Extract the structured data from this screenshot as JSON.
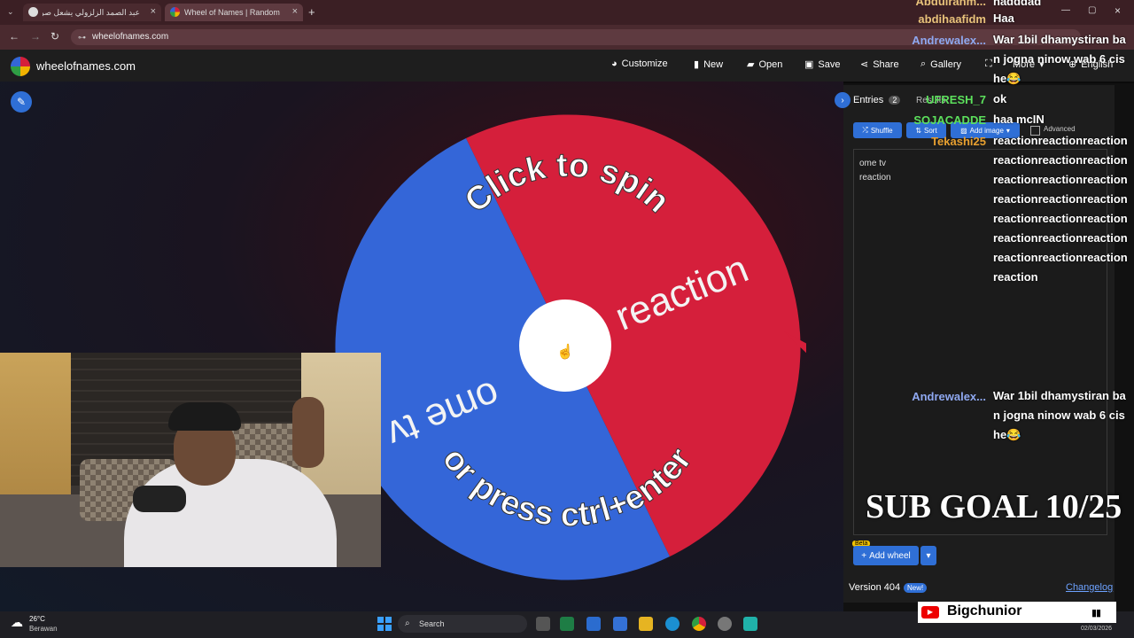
{
  "browser": {
    "tabs": [
      {
        "label": "عبد الصمد الزلزولي يشعل صراعا"
      },
      {
        "label": "Wheel of Names | Random nam"
      }
    ],
    "url": "wheelofnames.com"
  },
  "app": {
    "logo_text": "wheelofnames.com",
    "menu": [
      "Customize",
      "New",
      "Open",
      "Save",
      "Share",
      "Gallery",
      "More",
      "English"
    ]
  },
  "wheel": {
    "top_text": "Click to spin",
    "bottom_text": "or press ctrl+enter",
    "segments": [
      {
        "label": "reaction",
        "color": "#d51f3b"
      },
      {
        "label": "ome tv",
        "color": "#3466d8"
      }
    ]
  },
  "panel": {
    "tab_entries": "Entries",
    "entries_count": "2",
    "tab_results": "Results",
    "shuffle": "Shuffle",
    "sort": "Sort",
    "add_image": "Add image",
    "advanced": "Advanced",
    "entries": [
      "ome tv",
      "reaction"
    ],
    "add_wheel": "Add wheel",
    "beta": "Beta",
    "version": "Version 404",
    "new_badge": "New!",
    "changelog": "Changelog"
  },
  "chat": [
    {
      "user": "Abdulrahm...",
      "msg": "hadddad",
      "color": "#e8c27a"
    },
    {
      "user": "abdihaafidm",
      "msg": "Haa",
      "color": "#e8c27a"
    },
    {
      "user": "Andrewalex...",
      "msg": "War 1bil dhamystiran ban jogna ninow wab 6 cishe😂",
      "color": "#8fa8f0"
    },
    {
      "user": "UFRESH_7",
      "msg": "ok",
      "color": "#5ce05c"
    },
    {
      "user": "SOJACADDE",
      "msg": "haa mcIN",
      "color": "#5ce05c"
    },
    {
      "user": "Tekashi25",
      "msg": "reactionreactionreactionreactionreactionreactionreactionreactionreactionreactionreactionreactionreactionreactionreactionreactionreactionreactionreactionreactionreactionreaction",
      "color": "#e8a030"
    },
    {
      "user": "Andrewalex...",
      "msg": "War 1bil dhamystiran ban jogna ninow wab 6 cishe😂",
      "color": "#8fa8f0"
    }
  ],
  "overlay": {
    "sub_goal": "SUB GOAL 10/25",
    "channel": "Bigchunior"
  },
  "taskbar": {
    "weather_temp": "26°C",
    "weather_desc": "Berawan",
    "search": "Search",
    "date": "02/03/2026"
  }
}
